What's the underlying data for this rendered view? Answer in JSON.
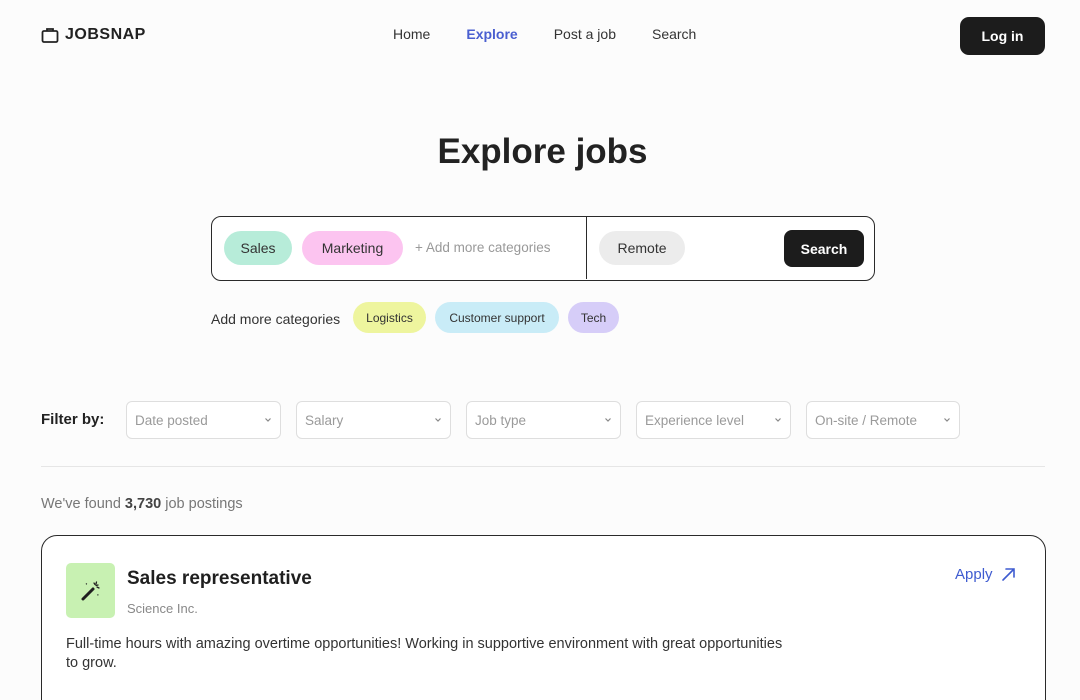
{
  "brand": {
    "name": "JOBSNAP"
  },
  "nav": {
    "links": [
      {
        "label": "Home",
        "active": false
      },
      {
        "label": "Explore",
        "active": true
      },
      {
        "label": "Post a job",
        "active": false
      },
      {
        "label": "Search",
        "active": false
      }
    ],
    "login_label": "Log in"
  },
  "hero": {
    "title": "Explore jobs"
  },
  "search": {
    "selected_categories": [
      "Sales",
      "Marketing"
    ],
    "add_categories_placeholder": "+ Add more categories",
    "location": "Remote",
    "button_label": "Search"
  },
  "suggestions": {
    "label": "Add more categories",
    "items": [
      "Logistics",
      "Customer support",
      "Tech"
    ]
  },
  "filters": {
    "label": "Filter by:",
    "options": [
      "Date posted",
      "Salary",
      "Job type",
      "Experience level",
      "On-site / Remote"
    ]
  },
  "results": {
    "prefix": "We've found",
    "count": "3,730",
    "suffix": "job postings"
  },
  "jobs": [
    {
      "title": "Sales representative",
      "company": "Science Inc.",
      "apply_label": "Apply",
      "description": "Full-time hours with amazing overtime opportunities! Working in supportive environment with great opportunities to grow."
    }
  ],
  "colors": {
    "accent": "#4a5fd0",
    "chip_sales": "#b7ecd9",
    "chip_marketing": "#fcc4f0",
    "chip_logistics": "#eef59e",
    "chip_support": "#c9ecf7",
    "chip_tech": "#d6cdf8",
    "job_icon_bg": "#c8f1b2"
  },
  "icons": {
    "logo": "briefcase-icon",
    "job": "magic-wand-icon",
    "apply": "arrow-up-right-icon",
    "select": "chevron-down-icon"
  }
}
